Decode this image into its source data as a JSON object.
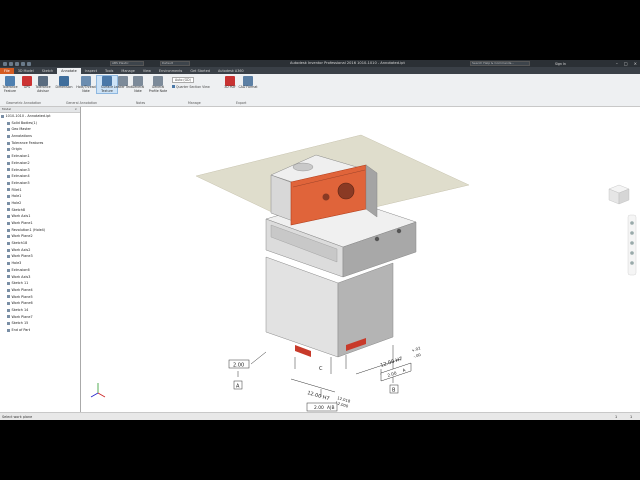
{
  "window": {
    "title": "Autodesk Inventor Professional 2016   1010-1010 - Annotated.ipt",
    "quick_access": [
      "new-icon",
      "open-icon",
      "save-icon",
      "undo-icon",
      "redo-icon"
    ],
    "search_placeholder": "Search Help & Commands...",
    "sign_in": "Sign In",
    "material": "ABS Plastic",
    "appearance": "Default"
  },
  "tabs": [
    "File",
    "3D Model",
    "Sketch",
    "Annotate",
    "Inspect",
    "Tools",
    "Manage",
    "View",
    "Environments",
    "Get Started",
    "Autodesk A360"
  ],
  "active_tab": "Annotate",
  "ribbon": {
    "buttons": [
      {
        "label": "Tolerance Feature",
        "icon": "tolerance-icon"
      },
      {
        "label": "GPS",
        "icon": "gps-icon"
      },
      {
        "label": "Tolerance Advisor",
        "icon": "advisor-icon"
      },
      {
        "label": "Dimension",
        "icon": "dimension-icon"
      },
      {
        "label": "Hole/Thread Note",
        "icon": "hole-note-icon"
      },
      {
        "label": "Surface Texture",
        "icon": "surface-texture-icon"
      },
      {
        "label": "Leader Text",
        "icon": "leader-text-icon"
      },
      {
        "label": "General Note",
        "icon": "general-note-icon"
      },
      {
        "label": "General Profile Note",
        "icon": "profile-note-icon"
      }
    ],
    "auto_select": "Auto (GD)",
    "quarter_section": "Quarter Section View",
    "export": [
      {
        "label": "3D PDF",
        "icon": "pdf-icon"
      },
      {
        "label": "CAD Format",
        "icon": "cad-icon"
      }
    ],
    "panels": [
      "Geometric Annotation",
      "General Annotation",
      "Notes",
      "Manage",
      "Export"
    ]
  },
  "browser": {
    "header": "Model",
    "items": [
      "1010-1010 - Annotated.ipt",
      "Solid Bodies(1)",
      "Geo Master",
      "Annotations",
      "Tolerance Features",
      "Origin",
      "Extrusion1",
      "Extrusion2",
      "Extrusion3",
      "Extrusion4",
      "Extrusion5",
      "Fillet1",
      "Hole1",
      "Hole2",
      "Sketch8",
      "Work Axis1",
      "Work Plane1",
      "Revolution1 (Hole4)",
      "Work Plane2",
      "Sketch18",
      "Work Axis2",
      "Work Plane3",
      "Hole3",
      "Extrusion6",
      "Work Axis3",
      "Sketch 11",
      "Work Plane4",
      "Work Plane5",
      "Work Plane6",
      "Sketch 14",
      "Work Plane7",
      "Sketch 15",
      "End of Part"
    ]
  },
  "annotations": {
    "dim_left": "2.00",
    "datum_a": "A",
    "dim_bottom": "12.00 H7",
    "tol_bottom_upper": "12.018",
    "tol_bottom_lower": "12.000",
    "fcf_bottom_value": "2.00",
    "fcf_bottom_ref": "A|B",
    "datum_c": "C",
    "dim_right": "12.00 H7",
    "tol_right_upper": "+.02",
    "tol_right_lower": "-.00",
    "fcf_right_value": "2.00",
    "fcf_right_ref": "A",
    "datum_b": "B"
  },
  "status": {
    "text": "Select work plane",
    "count1": "1",
    "count2": "1"
  },
  "colors": {
    "accent": "#d35b22",
    "highlight_face": "#e0643a",
    "plane": "#d8d5c0"
  }
}
